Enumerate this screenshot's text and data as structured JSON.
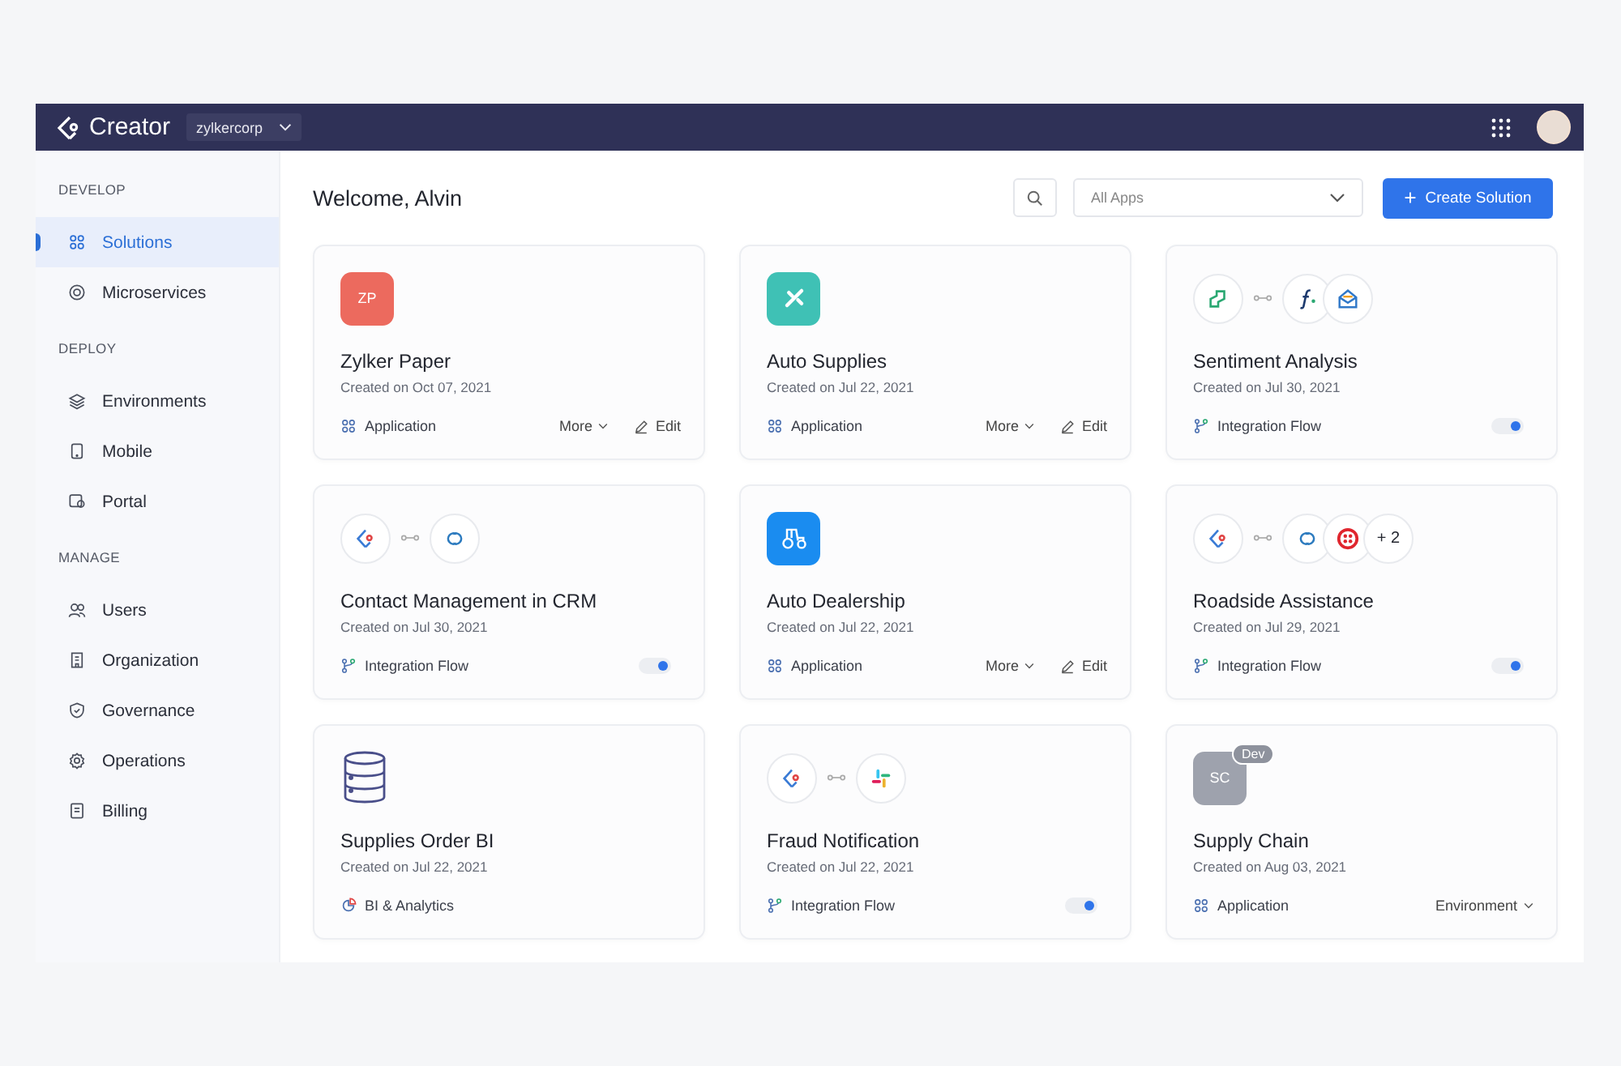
{
  "header": {
    "logo": "Creator",
    "org": "zylkercorp"
  },
  "sidebar": {
    "sections": [
      {
        "title": "DEVELOP",
        "items": [
          {
            "label": "Solutions",
            "kind": "grid",
            "selected": true
          },
          {
            "label": "Microservices",
            "kind": "ring",
            "selected": false
          }
        ]
      },
      {
        "title": "DEPLOY",
        "items": [
          {
            "label": "Environments",
            "kind": "layers",
            "selected": false
          },
          {
            "label": "Mobile",
            "kind": "phone",
            "selected": false
          },
          {
            "label": "Portal",
            "kind": "portal",
            "selected": false
          }
        ]
      },
      {
        "title": "MANAGE",
        "items": [
          {
            "label": "Users",
            "kind": "users",
            "selected": false
          },
          {
            "label": "Organization",
            "kind": "building",
            "selected": false
          },
          {
            "label": "Governance",
            "kind": "shield",
            "selected": false
          },
          {
            "label": "Operations",
            "kind": "gear",
            "selected": false
          },
          {
            "label": "Billing",
            "kind": "receipt",
            "selected": false
          }
        ]
      }
    ]
  },
  "main": {
    "welcome": "Welcome, Alvin",
    "filter": "All Apps",
    "create_button": "Create Solution"
  },
  "cards": [
    {
      "title": "Zylker Paper",
      "created": "Created on Oct 07, 2021",
      "art": {
        "kind": "initials",
        "text": "ZP",
        "color": "#ec6a5e"
      },
      "type": {
        "kind": "application",
        "label": "Application"
      },
      "actions": [
        {
          "kind": "more",
          "label": "More"
        },
        {
          "kind": "edit",
          "label": "Edit"
        }
      ]
    },
    {
      "title": "Auto Supplies",
      "created": "Created on Jul 22, 2021",
      "art": {
        "kind": "tools",
        "color": "#3fc1b5"
      },
      "type": {
        "kind": "application",
        "label": "Application"
      },
      "actions": [
        {
          "kind": "more",
          "label": "More"
        },
        {
          "kind": "edit",
          "label": "Edit"
        }
      ]
    },
    {
      "title": "Sentiment Analysis",
      "created": "Created on Jul 30, 2021",
      "art": {
        "kind": "integration",
        "from": [
          {
            "kind": "sentiment"
          }
        ],
        "to": [
          {
            "kind": "function"
          },
          {
            "kind": "mail"
          }
        ]
      },
      "type": {
        "kind": "flow",
        "label": "Integration Flow"
      },
      "toggle": {
        "on": true
      }
    },
    {
      "title": "Contact Management in CRM",
      "created": "Created on Jul 30, 2021",
      "art": {
        "kind": "integration",
        "from": [
          {
            "kind": "creator"
          }
        ],
        "to": [
          {
            "kind": "crm"
          }
        ]
      },
      "type": {
        "kind": "flow",
        "label": "Integration Flow"
      },
      "toggle": {
        "on": true
      }
    },
    {
      "title": "Auto Dealership",
      "created": "Created on Jul 22, 2021",
      "art": {
        "kind": "tractor",
        "color": "#1a8cf0"
      },
      "type": {
        "kind": "application",
        "label": "Application"
      },
      "actions": [
        {
          "kind": "more",
          "label": "More"
        },
        {
          "kind": "edit",
          "label": "Edit"
        }
      ]
    },
    {
      "title": "Roadside Assistance",
      "created": "Created on Jul 29, 2021",
      "art": {
        "kind": "integration",
        "from": [
          {
            "kind": "creator"
          }
        ],
        "to": [
          {
            "kind": "crm"
          },
          {
            "kind": "dots"
          }
        ],
        "extra": "+ 2"
      },
      "type": {
        "kind": "flow",
        "label": "Integration Flow"
      },
      "toggle": {
        "on": true
      }
    },
    {
      "title": "Supplies Order BI",
      "created": "Created on Jul 22, 2021",
      "art": {
        "kind": "database"
      },
      "type": {
        "kind": "bi",
        "label": "BI & Analytics"
      }
    },
    {
      "title": "Fraud Notification",
      "created": "Created on Jul 22, 2021",
      "art": {
        "kind": "integration",
        "from": [
          {
            "kind": "creator"
          }
        ],
        "to": [
          {
            "kind": "chat"
          }
        ]
      },
      "type": {
        "kind": "flow",
        "label": "Integration Flow"
      },
      "toggle": {
        "on": true
      }
    },
    {
      "title": "Supply Chain",
      "created": "Created on Aug 03, 2021",
      "art": {
        "kind": "initials",
        "text": "SC",
        "color": "#9ea2ad",
        "badge": "Dev"
      },
      "type": {
        "kind": "application",
        "label": "Application"
      },
      "actions": [
        {
          "kind": "environment",
          "label": "Environment"
        }
      ]
    }
  ]
}
